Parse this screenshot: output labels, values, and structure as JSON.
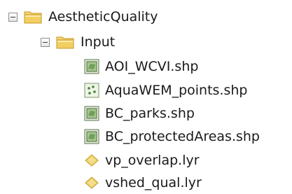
{
  "tree": {
    "root": {
      "label": "AestheticQuality",
      "icon": "folder-icon",
      "expanded": true
    },
    "input_folder": {
      "label": "Input",
      "icon": "folder-icon",
      "expanded": true
    },
    "items": [
      {
        "label": "AOI_WCVI.shp",
        "icon": "polygon-shapefile-icon"
      },
      {
        "label": "AquaWEM_points.shp",
        "icon": "point-shapefile-icon"
      },
      {
        "label": "BC_parks.shp",
        "icon": "polygon-shapefile-icon"
      },
      {
        "label": "BC_protectedAreas.shp",
        "icon": "polygon-shapefile-icon"
      },
      {
        "label": "vp_overlap.lyr",
        "icon": "layer-file-icon"
      },
      {
        "label": "vshed_qual.lyr",
        "icon": "layer-file-icon"
      }
    ]
  },
  "colors": {
    "folder_yellow": "#f3cf63",
    "shapefile_green": "#6f9f5a",
    "layer_gold": "#e8c34a",
    "tree_toggle_border": "#8f8f8f"
  }
}
